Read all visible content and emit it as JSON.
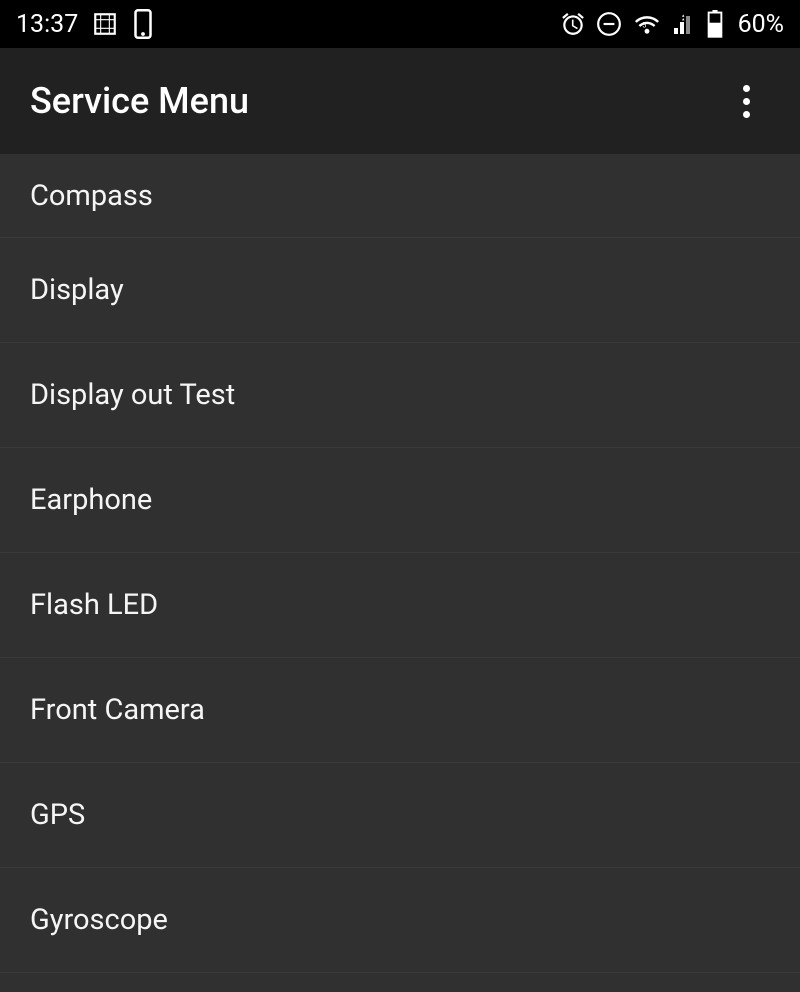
{
  "statusBar": {
    "time": "13:37",
    "battery": "60%"
  },
  "appBar": {
    "title": "Service Menu"
  },
  "menu": {
    "items": [
      {
        "label": "Compass"
      },
      {
        "label": "Display"
      },
      {
        "label": "Display out Test"
      },
      {
        "label": "Earphone"
      },
      {
        "label": "Flash LED"
      },
      {
        "label": "Front Camera"
      },
      {
        "label": "GPS"
      },
      {
        "label": "Gyroscope"
      }
    ]
  }
}
